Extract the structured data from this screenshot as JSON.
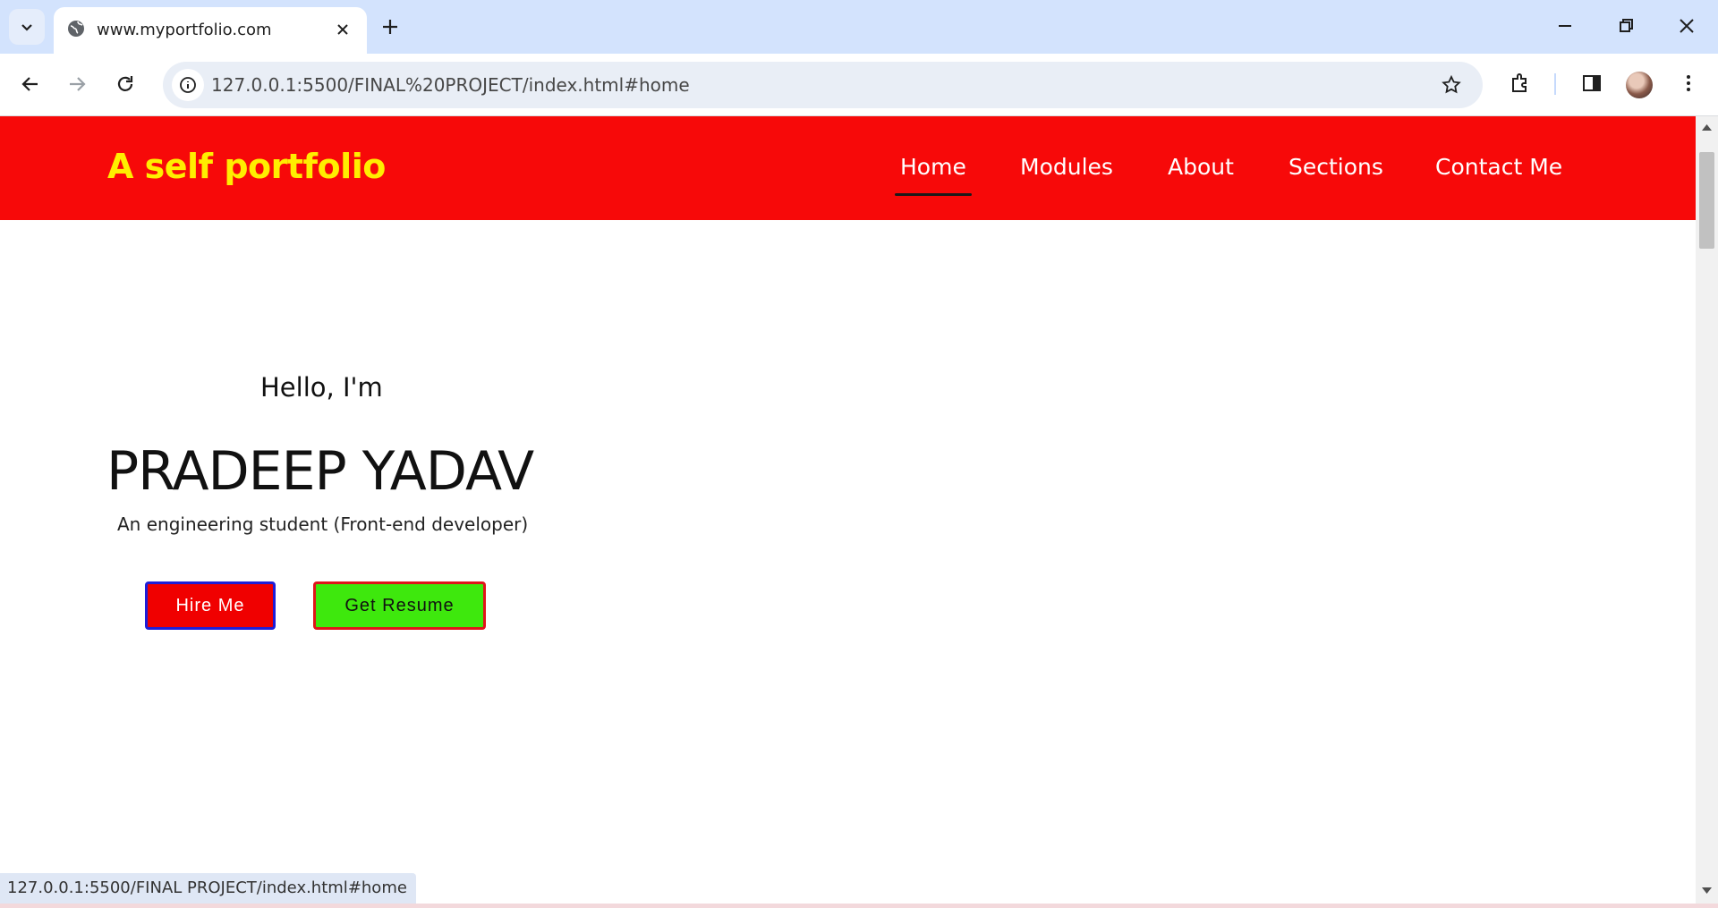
{
  "browser": {
    "tab_title": "www.myportfolio.com",
    "url": "127.0.0.1:5500/FINAL%20PROJECT/index.html#home",
    "status_url": "127.0.0.1:5500/FINAL PROJECT/index.html#home",
    "icons": [
      "tab-search-icon",
      "globe-icon",
      "close-icon",
      "plus-icon",
      "minimize-icon",
      "restore-icon",
      "window-close-icon",
      "back-icon",
      "forward-icon",
      "reload-icon",
      "site-info-icon",
      "star-icon",
      "extensions-icon",
      "side-panel-icon",
      "avatar",
      "kebab-menu-icon"
    ]
  },
  "site": {
    "logo": "A self portfolio",
    "nav": [
      {
        "label": "Home",
        "active": true
      },
      {
        "label": "Modules",
        "active": false
      },
      {
        "label": "About",
        "active": false
      },
      {
        "label": "Sections",
        "active": false
      },
      {
        "label": "Contact Me",
        "active": false
      }
    ],
    "hero": {
      "greeting": "Hello, I'm",
      "name": "PRADEEP YADAV",
      "tagline": "An engineering student (Front-end developer)",
      "hire_label": "Hire Me",
      "resume_label": "Get Resume"
    }
  },
  "colors": {
    "header_bg": "#f70909",
    "logo": "#ffee00",
    "hire_bg": "#f00000",
    "hire_border": "#1e1ed8",
    "resume_bg": "#3ee80d",
    "resume_border": "#e0141a",
    "tabstrip": "#d3e3fd"
  }
}
